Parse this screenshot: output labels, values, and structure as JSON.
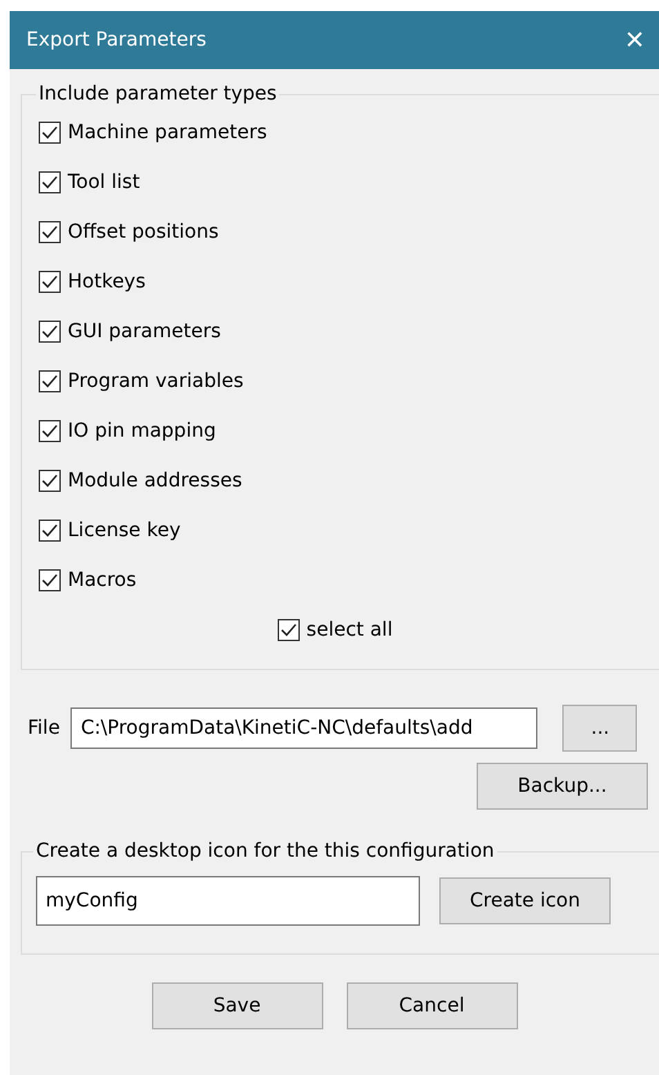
{
  "window": {
    "title": "Export Parameters",
    "close": "✕"
  },
  "group": {
    "title": "Include parameter types",
    "items": [
      {
        "label": "Machine parameters",
        "checked": true
      },
      {
        "label": "Tool list",
        "checked": true
      },
      {
        "label": "Offset positions",
        "checked": true
      },
      {
        "label": "Hotkeys",
        "checked": true
      },
      {
        "label": "GUI parameters",
        "checked": true
      },
      {
        "label": "Program variables",
        "checked": true
      },
      {
        "label": "IO pin mapping",
        "checked": true
      },
      {
        "label": "Module addresses",
        "checked": true
      },
      {
        "label": "License key",
        "checked": true
      },
      {
        "label": "Macros",
        "checked": true
      }
    ],
    "select_all": {
      "label": "select all",
      "checked": true
    }
  },
  "file": {
    "label": "File",
    "value": "C:\\ProgramData\\KinetiC-NC\\defaults\\add",
    "browse": "...",
    "backup": "Backup..."
  },
  "desktop": {
    "title": "Create a desktop icon for the this configuration",
    "value": "myConfig",
    "button": "Create icon"
  },
  "buttons": [
    "Save",
    "Cancel"
  ]
}
